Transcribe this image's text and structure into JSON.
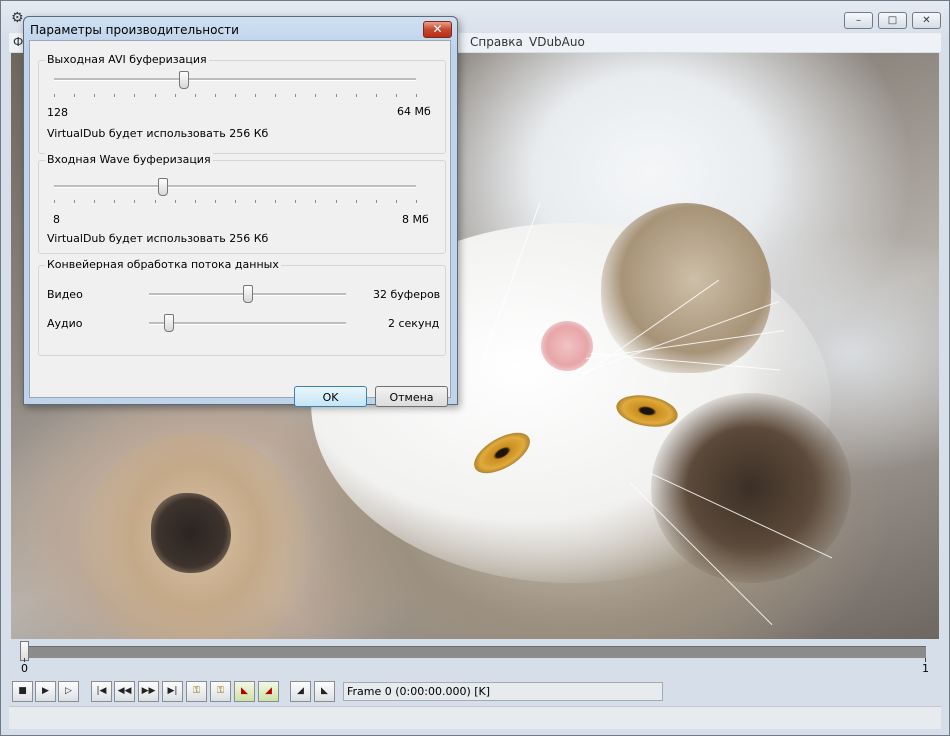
{
  "window": {
    "menu": [
      "Ф",
      "Справка",
      "VDubAuo"
    ],
    "caption_buttons": {
      "minimize": "–",
      "maximize": "□",
      "close": "✕"
    }
  },
  "timeline": {
    "start_label": "0",
    "end_label": "1",
    "position": 0
  },
  "toolbar": {
    "frame_status": "Frame 0 (0:00:00.000) [K]",
    "icons": [
      "stop-icon",
      "play-input-icon",
      "play-output-icon",
      "start-icon",
      "prev-icon",
      "next-icon",
      "end-icon",
      "prev-key-icon",
      "next-key-icon",
      "prev-scene-icon",
      "next-scene-icon",
      "mark-in-icon",
      "mark-out-icon"
    ]
  },
  "dialog": {
    "title": "Параметры производительности",
    "close_glyph": "✕",
    "avi": {
      "group_title": "Выходная AVI буферизация",
      "min_label": "128",
      "max_label": "64 Мб",
      "info": "VirtualDub будет использовать 256 Кб",
      "level": 0.36
    },
    "wave": {
      "group_title": "Входная Wave буферизация",
      "min_label": "8",
      "max_label": "8 Мб",
      "info": "VirtualDub будет использовать 256 Кб",
      "level": 0.3
    },
    "pipeline": {
      "group_title": "Конвейерная обработка потока данных",
      "video_label": "Видео",
      "video_value": "32 буферов",
      "video_level": 0.5,
      "audio_label": "Аудио",
      "audio_value": "2 секунд",
      "audio_level": 0.1
    },
    "ok_label": "OK",
    "cancel_label": "Отмена"
  }
}
